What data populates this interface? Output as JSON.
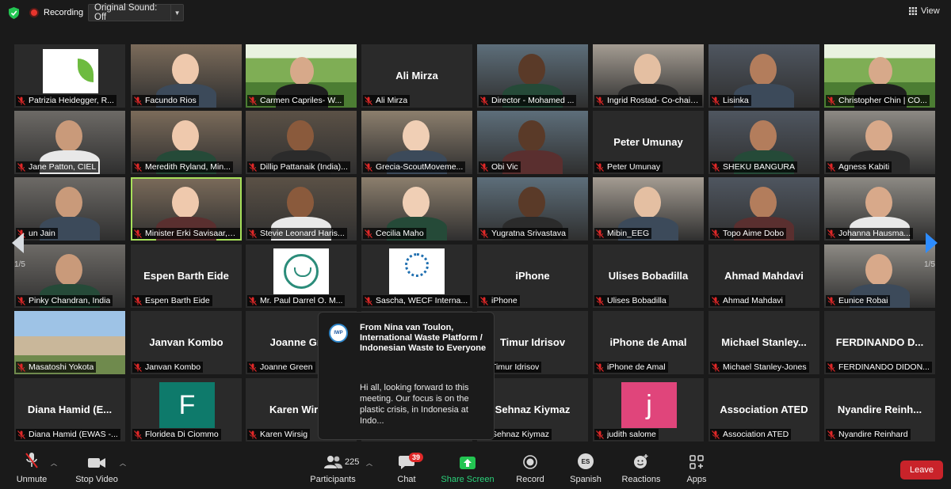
{
  "topbar": {
    "recording_label": "Recording",
    "sound_label": "Original Sound: Off",
    "view_label": "View"
  },
  "colors": {
    "accent": "#2d8cff",
    "record": "#e8352d",
    "leave": "#c9232a",
    "share": "#2bd27a",
    "active_speaker": "#a7e05a"
  },
  "tiles": [
    {
      "label": "Patrizia Heidegger, R...",
      "kind": "logo-eeb"
    },
    {
      "label": "Facundo Rios",
      "kind": "video"
    },
    {
      "label": "Carmen Capriles- W...",
      "kind": "banner"
    },
    {
      "label": "Ali Mirza",
      "kind": "name",
      "center": "Ali Mirza"
    },
    {
      "label": "Director - Mohamed ...",
      "kind": "video"
    },
    {
      "label": "Ingrid Rostad- Co-chair, ...",
      "kind": "video"
    },
    {
      "label": "Lisinka",
      "kind": "video"
    },
    {
      "label": "Christopher Chin | CO...",
      "kind": "banner"
    },
    {
      "label": "Jane Patton, CIEL",
      "kind": "video"
    },
    {
      "label": "Meredith Ryland, Min...",
      "kind": "video"
    },
    {
      "label": "Dillip Pattanaik (India)...",
      "kind": "video"
    },
    {
      "label": "Grecia-ScoutMoveme...",
      "kind": "video"
    },
    {
      "label": "Obi Vic",
      "kind": "video"
    },
    {
      "label": "Peter Umunay",
      "kind": "name",
      "center": "Peter Umunay"
    },
    {
      "label": "SHEKU BANGURA",
      "kind": "video"
    },
    {
      "label": "Agness Kabiti",
      "kind": "video"
    },
    {
      "label": "un Jain",
      "kind": "video"
    },
    {
      "label": "Minister Erki Savisaar, E...",
      "kind": "video",
      "active": true
    },
    {
      "label": "Stevie Leonard Haris...",
      "kind": "video"
    },
    {
      "label": "Cecilia Maho",
      "kind": "video"
    },
    {
      "label": "Yugratna Srivastava",
      "kind": "video"
    },
    {
      "label": "Mibin_EEG",
      "kind": "video"
    },
    {
      "label": "Topo Aime Dobo",
      "kind": "video"
    },
    {
      "label": "Johanna Hausma...",
      "kind": "video"
    },
    {
      "label": "Pinky Chandran, India",
      "kind": "video"
    },
    {
      "label": "Espen Barth Eide",
      "kind": "name",
      "center": "Espen Barth Eide"
    },
    {
      "label": "Mr. Paul Darrel O. M...",
      "kind": "logo-round"
    },
    {
      "label": "Sascha, WECF Interna...",
      "kind": "logo-wecf"
    },
    {
      "label": "iPhone",
      "kind": "name",
      "center": "iPhone"
    },
    {
      "label": "Ulises Bobadilla",
      "kind": "name",
      "center": "Ulises Bobadilla"
    },
    {
      "label": "Ahmad Mahdavi",
      "kind": "name",
      "center": "Ahmad Mahdavi"
    },
    {
      "label": "Eunice Robai",
      "kind": "video"
    },
    {
      "label": "Masatoshi Yokota",
      "kind": "photo"
    },
    {
      "label": "Janvan Kombo",
      "kind": "name",
      "center": "Janvan Kombo"
    },
    {
      "label": "Joanne Green",
      "kind": "name",
      "center": "Joanne Gree"
    },
    {
      "label": "",
      "kind": "hidden"
    },
    {
      "label": "Timur Idrisov",
      "kind": "name",
      "center": "Timur Idrisov"
    },
    {
      "label": "iPhone de Amal",
      "kind": "name",
      "center": "iPhone de Amal"
    },
    {
      "label": "Michael Stanley-Jones",
      "kind": "name",
      "center": "Michael  Stanley..."
    },
    {
      "label": "FERDINANDO DIDON...",
      "kind": "name",
      "center": "FERDINANDO D..."
    },
    {
      "label": "Diana Hamid (EWAS -...",
      "kind": "name",
      "center": "Diana Hamid  (E..."
    },
    {
      "label": "Floridea Di Ciommo",
      "kind": "avatar",
      "letter": "F",
      "color": "#0e7a6b"
    },
    {
      "label": "Karen Wirsig",
      "kind": "name",
      "center": "Karen Wirsig"
    },
    {
      "label": "",
      "kind": "hidden"
    },
    {
      "label": "Sehnaz Kiymaz",
      "kind": "name",
      "center": "Sehnaz Kiymaz"
    },
    {
      "label": "judith salome",
      "kind": "avatar",
      "letter": "j",
      "color": "#e0457b"
    },
    {
      "label": "Association ATED",
      "kind": "name",
      "center": "Association ATED"
    },
    {
      "label": "Nyandire Reinhard",
      "kind": "name",
      "center": "Nyandire  Reinh..."
    }
  ],
  "pagination": {
    "left": "1/5",
    "right": "1/5"
  },
  "chat_popup": {
    "logo_text": "IWP",
    "from": "From Nina van Toulon, International Waste Platform / Indonesian Waste to Everyone",
    "message": "Hi all, looking forward to this meeting. Our focus is on the plastic crisis, in Indonesia at Indo..."
  },
  "toolbar": {
    "unmute": "Unmute",
    "stop_video": "Stop Video",
    "participants": "Participants",
    "participants_count": "225",
    "chat": "Chat",
    "chat_badge": "39",
    "share_screen": "Share Screen",
    "record": "Record",
    "spanish": "Spanish",
    "spanish_icon": "ES",
    "reactions": "Reactions",
    "apps": "Apps",
    "leave": "Leave"
  }
}
